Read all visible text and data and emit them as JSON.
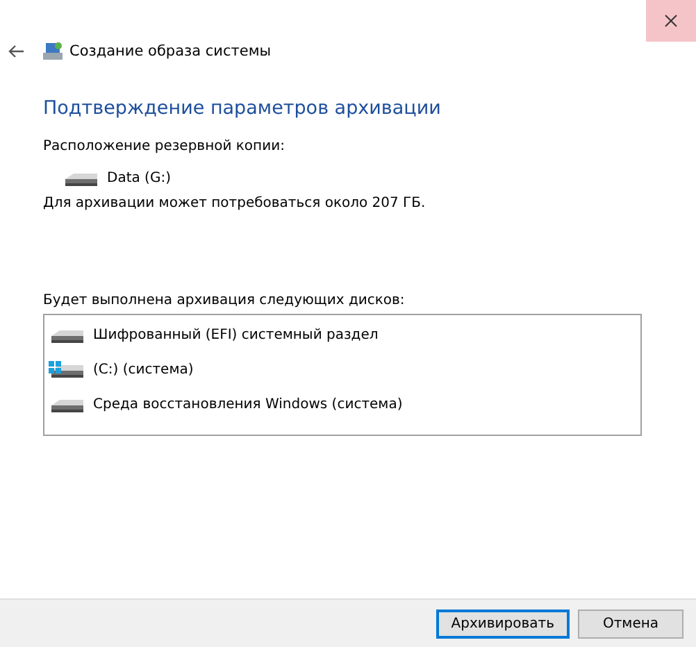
{
  "window": {
    "title": "Создание образа системы"
  },
  "heading": "Подтверждение параметров архивации",
  "location": {
    "label": "Расположение резервной копии:",
    "drive": "Data (G:)"
  },
  "space_note": "Для архивации может потребоваться около 207 ГБ.",
  "disks": {
    "label": "Будет выполнена архивация следующих дисков:",
    "items": [
      {
        "name": "Шифрованный (EFI) системный раздел",
        "kind": "drive"
      },
      {
        "name": "(C:) (система)",
        "kind": "system"
      },
      {
        "name": "Среда восстановления Windows (система)",
        "kind": "drive"
      }
    ]
  },
  "buttons": [
    {
      "label": "Архивировать",
      "default": true
    },
    {
      "label": "Отмена",
      "default": false
    }
  ]
}
